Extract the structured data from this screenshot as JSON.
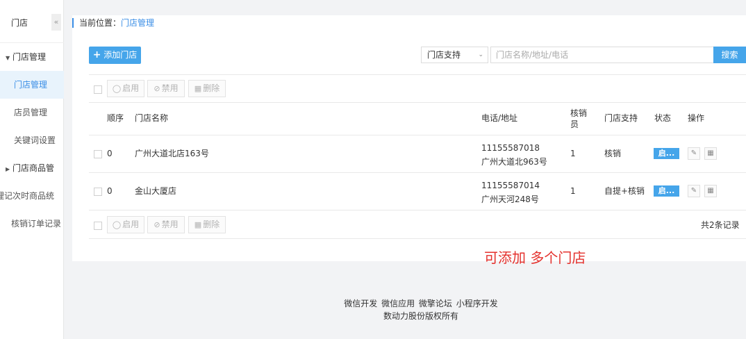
{
  "sidebar": {
    "title": "门店",
    "collapse_icon": "«",
    "groups": [
      {
        "label": "门店管理",
        "caret": "▼"
      },
      {
        "label": "门店商品管",
        "caret": "▶"
      }
    ],
    "items": [
      {
        "label": "门店管理"
      },
      {
        "label": "店员管理"
      },
      {
        "label": "关键词设置"
      },
      {
        "label": "理记次时商品统"
      },
      {
        "label": "核销订单记录"
      }
    ]
  },
  "breadcrumb": {
    "prefix": "当前位置：",
    "current": "门店管理"
  },
  "toolbar": {
    "add_label": "添加门店",
    "add_icon": "+",
    "select_value": "门店支持",
    "search_placeholder": "门店名称/地址/电话",
    "search_label": "搜索"
  },
  "bulk": {
    "enable": "启用",
    "disable": "禁用",
    "delete": "删除"
  },
  "table": {
    "headers": {
      "order": "顺序",
      "name": "门店名称",
      "contact": "电话/地址",
      "verifier": "核销员",
      "support": "门店支持",
      "status": "状态",
      "ops": "操作"
    },
    "rows": [
      {
        "order": "0",
        "name": "广州大道北店163号",
        "phone": "11155587018",
        "address": "广州大道北963号",
        "verifier": "1",
        "support": "核销",
        "status": "启..."
      },
      {
        "order": "0",
        "name": "金山大厦店",
        "phone": "11155587014",
        "address": "广州天河248号",
        "verifier": "1",
        "support": "自提+核销",
        "status": "启..."
      }
    ],
    "total": "共2条记录"
  },
  "annotation": "可添加 多个门店",
  "footer": {
    "links": [
      "微信开发",
      "微信应用",
      "微擎论坛",
      "小程序开发"
    ],
    "copyright": "数动力股份版权所有"
  },
  "colors": {
    "accent": "#45a5ea",
    "note": "#e4302c",
    "active_bg": "#e8f3fc"
  }
}
